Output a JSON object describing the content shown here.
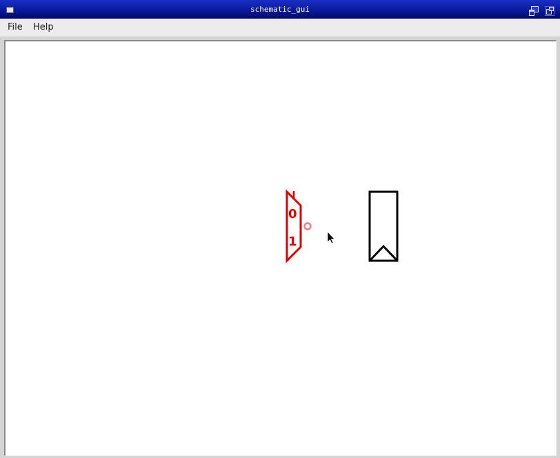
{
  "window": {
    "title": "schematic_gui",
    "title_color": "#ffffff",
    "titlebar_color": "#0a1a9a"
  },
  "menu": {
    "items": [
      {
        "label": "File"
      },
      {
        "label": "Help"
      }
    ]
  },
  "canvas": {
    "background": "#ffffff",
    "mux": {
      "input_labels": [
        "0",
        "1"
      ],
      "color": "#e00000",
      "state": "selected"
    },
    "output_pin": {
      "color": "#f08080"
    },
    "block": {
      "color": "#000000"
    }
  },
  "icons": {
    "window_menu": "window-menu-icon",
    "restore": "restore-icon",
    "maximize": "maximize-icon",
    "cursor": "mouse-pointer-icon"
  }
}
